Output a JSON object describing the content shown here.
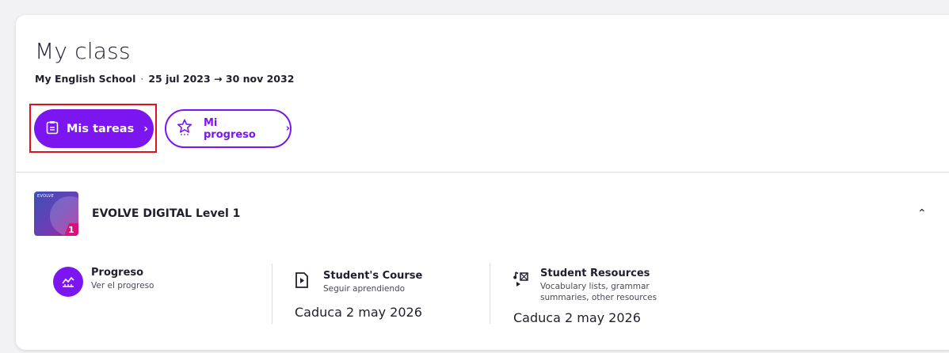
{
  "header": {
    "title": "My class",
    "school": "My English School",
    "separator": "·",
    "date_range": "25 jul 2023 → 30 nov 2032"
  },
  "actions": {
    "tasks_label": "Mis tareas",
    "progress_label": "Mi progreso",
    "chevron": "›"
  },
  "course": {
    "cover_brand": "EVOLVE",
    "cover_level": "1",
    "title": "EVOLVE DIGITAL Level 1",
    "collapse": "⌃"
  },
  "resources": [
    {
      "name": "Progreso",
      "desc": "Ver el progreso",
      "expires": "",
      "icon": "chart-icon"
    },
    {
      "name": "Student's Course",
      "desc": "Seguir aprendiendo",
      "expires": "Caduca 2 may 2026",
      "icon": "course-icon"
    },
    {
      "name": "Student Resources",
      "desc": "Vocabulary lists, grammar summaries, other resources",
      "expires": "Caduca 2 may 2026",
      "icon": "media-icon"
    }
  ],
  "colors": {
    "accent": "#7b16f0",
    "highlight": "#e5101d"
  }
}
